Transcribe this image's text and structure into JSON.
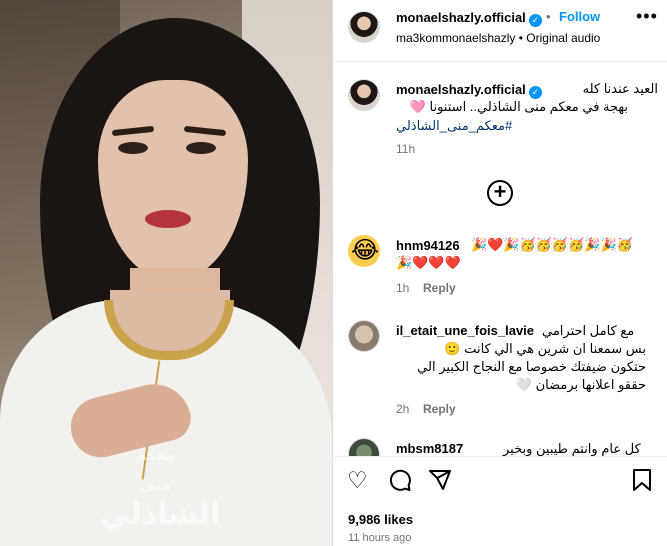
{
  "header": {
    "username": "monaelshazly.official",
    "separator": "•",
    "follow_label": "Follow",
    "more_label": "•••",
    "audio_user": "ma3kommonaelshazly",
    "audio_label": "Original audio"
  },
  "media": {
    "watermark_line1": "معكم",
    "watermark_line2": "منى",
    "watermark_line3": "الشاذلي"
  },
  "caption": {
    "username": "monaelshazly.official",
    "line1": "العيد عندنا كله",
    "line2": "بهجة في معكم منى الشاذلي.. استنونا 🩷",
    "hashtag": "#معكم_منى_الشاذلي",
    "time": "11h"
  },
  "load_more_icon": "plus-circle-icon",
  "comments": [
    {
      "username": "hnm94126",
      "text_line1": "🎉❤️🎉🥳🥳🥳🥳🎉🎉🥳",
      "text_line2": "🎉❤️❤️❤️",
      "time": "1h",
      "reply": "Reply",
      "avatar": "laughing-emoji"
    },
    {
      "username": "il_etait_une_fois_lavie",
      "text_line1": "مع كامل احترامي",
      "text_line2": "بس سمعنا ان شرين هي الي كانت 🙂",
      "text_line3": "حتكون ضيفتك خصوصا مع النجاح الكبير الي",
      "text_line4": "حققو اعلانها برمضان 🤍",
      "time": "2h",
      "reply": "Reply"
    },
    {
      "username": "mbsm8187",
      "text_line1": "كل عام وانتم طيبين وبخير"
    }
  ],
  "actions": {
    "likes": "9,986 likes",
    "ago": "11 hours ago"
  },
  "colors": {
    "accent": "#0095f6",
    "muted": "#737373",
    "hashtag": "#00376b"
  }
}
